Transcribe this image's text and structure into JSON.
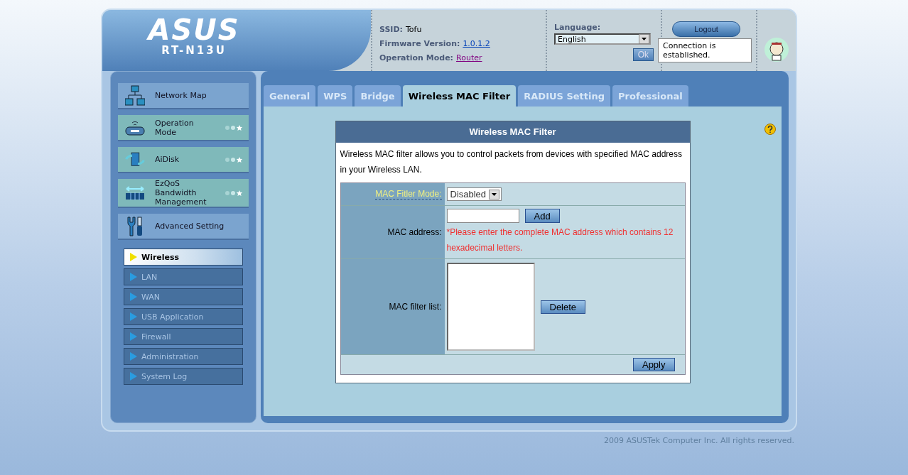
{
  "header": {
    "logo": "ASUS",
    "model": "RT-N13U",
    "info": [
      {
        "label": "SSID:",
        "value": "Tofu",
        "kind": "plain"
      },
      {
        "label": "Firmware Version:",
        "value": "1.0.1.2",
        "kind": "link"
      },
      {
        "label": "Operation Mode:",
        "value": "Router",
        "kind": "visited"
      }
    ],
    "language": {
      "label": "Language:",
      "value": "English",
      "ok": "Ok"
    },
    "logout": "Logout",
    "status": "Connection is established."
  },
  "sidebar": {
    "items": [
      {
        "label": "Network Map",
        "kind": "plain"
      },
      {
        "label": "Operation Mode",
        "kind": "quick"
      },
      {
        "label": "AiDisk",
        "kind": "quick"
      },
      {
        "label": "EzQoS Bandwidth Management",
        "kind": "quick"
      },
      {
        "label": "Advanced Setting",
        "kind": "plain"
      }
    ],
    "submenu": [
      {
        "label": "Wireless",
        "selected": true
      },
      {
        "label": "LAN",
        "selected": false
      },
      {
        "label": "WAN",
        "selected": false
      },
      {
        "label": "USB Application",
        "selected": false
      },
      {
        "label": "Firewall",
        "selected": false
      },
      {
        "label": "Administration",
        "selected": false
      },
      {
        "label": "System Log",
        "selected": false
      }
    ]
  },
  "tabs": [
    {
      "label": "General",
      "selected": false
    },
    {
      "label": "WPS",
      "selected": false
    },
    {
      "label": "Bridge",
      "selected": false
    },
    {
      "label": "Wireless MAC Filter",
      "selected": true
    },
    {
      "label": "RADIUS Setting",
      "selected": false
    },
    {
      "label": "Professional",
      "selected": false
    }
  ],
  "panel": {
    "title": "Wireless MAC Filter",
    "description": "Wireless MAC filter allows you to control packets from devices with specified MAC address in your Wireless LAN.",
    "mode_label": "MAC Fitler Mode:",
    "mode_value": "Disabled",
    "address_label": "MAC address:",
    "add": "Add",
    "hint": "*Please enter the complete MAC address which contains 12 hexadecimal letters.",
    "list_label": "MAC filter list:",
    "delete": "Delete",
    "apply": "Apply"
  },
  "footer": "2009 ASUSTek Computer Inc. All rights reserved."
}
